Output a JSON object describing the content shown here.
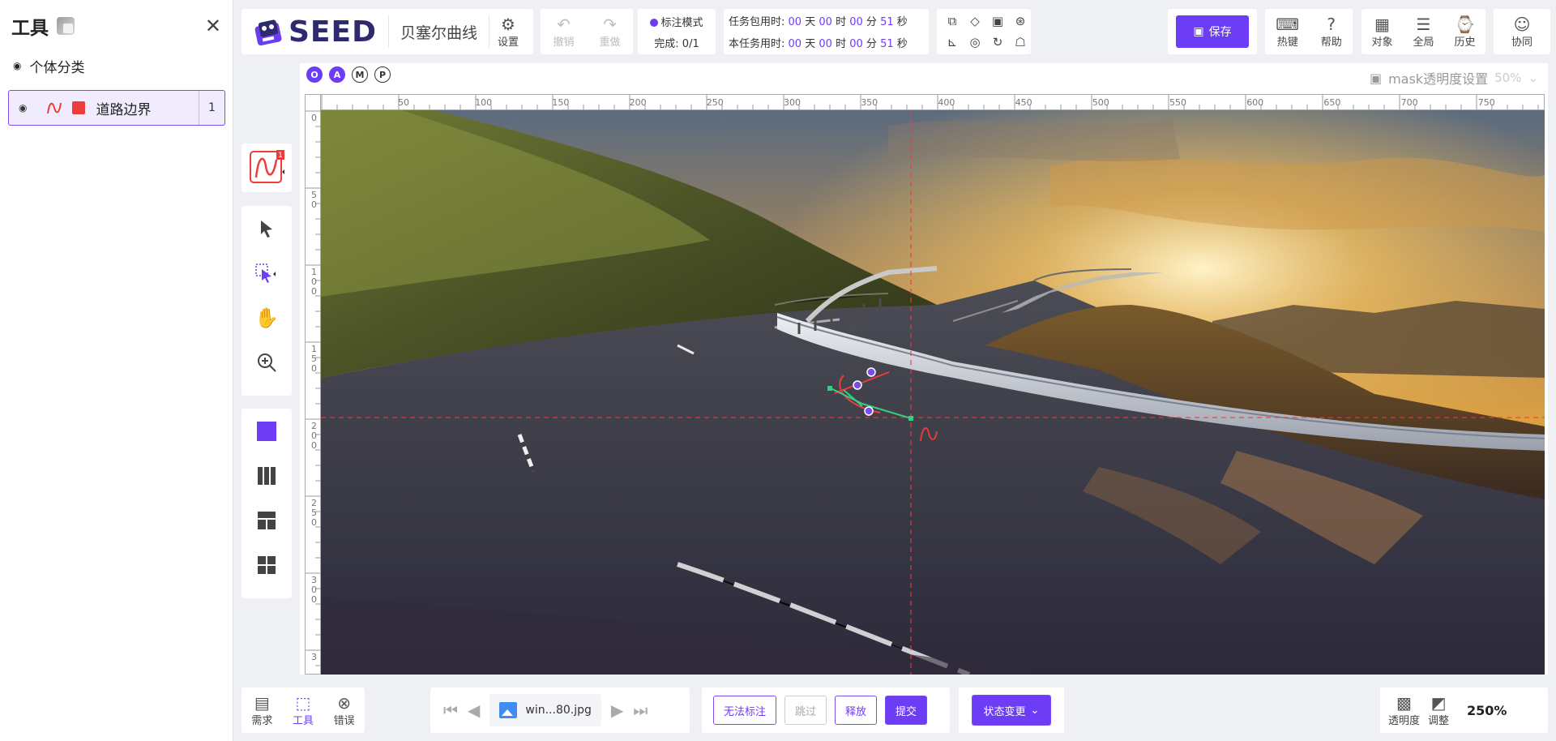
{
  "left_panel": {
    "title": "工具",
    "category_label": "个体分类",
    "item": {
      "name": "道路边界",
      "count": "1",
      "color": "#f03b3b"
    }
  },
  "header": {
    "brand": "SEED",
    "tool_name": "贝塞尔曲线",
    "settings_label": "设置",
    "undo_label": "撤销",
    "redo_label": "重做",
    "mode_label": "标注模式",
    "progress": "完成: 0/1",
    "timer_package_label": "任务包用时:",
    "timer_task_label": "本任务用时:",
    "timer_package": {
      "days": "00",
      "hours": "00",
      "minutes": "00",
      "seconds": "51"
    },
    "timer_task": {
      "days": "00",
      "hours": "00",
      "minutes": "00",
      "seconds": "51"
    },
    "unit_day": "天",
    "unit_hour": "时",
    "unit_minute": "分",
    "unit_second": "秒",
    "save_label": "保存",
    "hotkey_label": "热键",
    "help_label": "帮助",
    "object_label": "对象",
    "global_label": "全局",
    "history_label": "历史",
    "collab_label": "协同",
    "accent_color": "#6d3df5"
  },
  "workspace": {
    "modes": [
      "O",
      "A",
      "M",
      "P"
    ],
    "mask_label": "mask透明度设置",
    "mask_value": "50%",
    "ruler_top": [
      "50",
      "100",
      "150",
      "200",
      "250",
      "300",
      "350",
      "400",
      "450",
      "500",
      "550",
      "600",
      "650",
      "700",
      "750"
    ],
    "ruler_left": [
      "0",
      "5 0",
      "1 0 0",
      "1 5 0",
      "2 0 0",
      "2 5 0",
      "3 0 0",
      "3"
    ]
  },
  "tool_badge": "1",
  "bottom": {
    "req_label": "需求",
    "tool_label": "工具",
    "error_label": "错误",
    "filename": "win...80.jpg",
    "cannot_label": "无法标注",
    "skip_label": "跳过",
    "release_label": "释放",
    "submit_label": "提交",
    "status_label": "状态变更",
    "opacity_label": "透明度",
    "adjust_label": "调整",
    "zoom": "250%"
  }
}
